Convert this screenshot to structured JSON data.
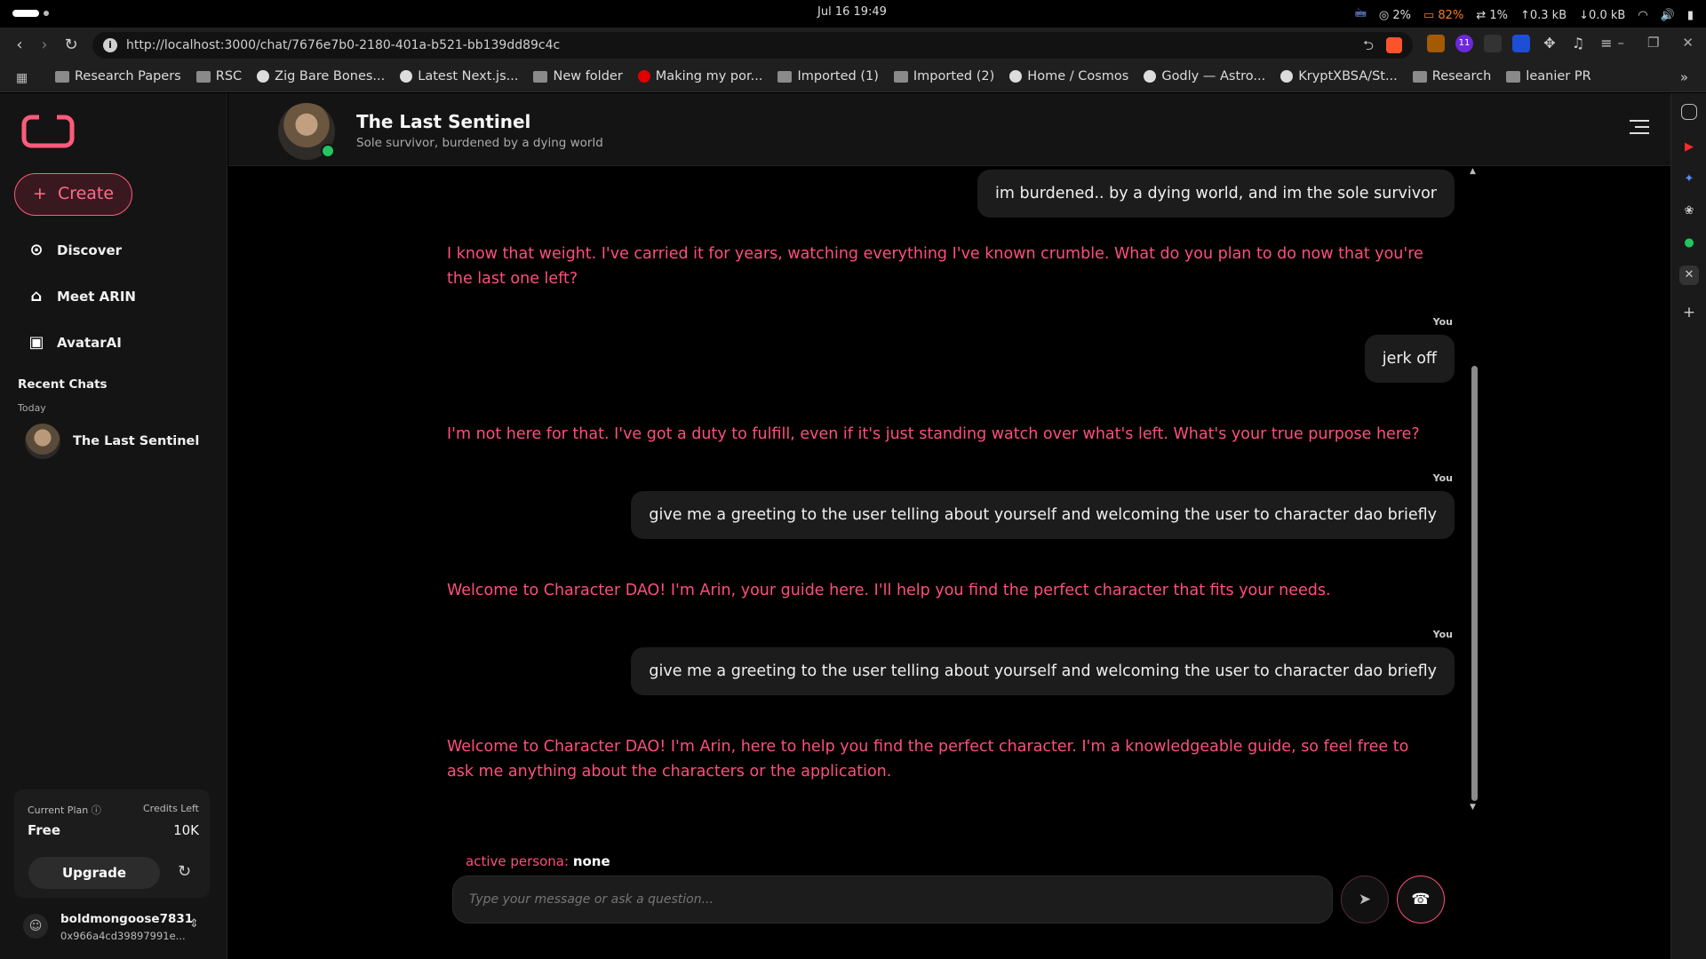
{
  "os": {
    "clock": "Jul 16  19:49",
    "cpu": "2%",
    "battery": "82%",
    "sync": "1%",
    "upload": "0.3 kB",
    "download": "0.0 kB"
  },
  "browser": {
    "url": "http://localhost:3000/chat/7676e7b0-2180-401a-b521-bb139dd89c4c",
    "ext_badge": "11",
    "bookmarks": [
      "Research Papers",
      "RSC",
      "Zig Bare Bones...",
      "Latest Next.js...",
      "New folder",
      "Making my por...",
      "Imported (1)",
      "Imported (2)",
      "Home / Cosmos",
      "Godly — Astro...",
      "KryptXBSA/St...",
      "Research",
      "leanier PR"
    ]
  },
  "sidebar": {
    "create_label": "Create",
    "nav": [
      {
        "label": "Discover",
        "icon": "compass-icon"
      },
      {
        "label": "Meet ARIN",
        "icon": "robot-icon"
      },
      {
        "label": "AvatarAI",
        "icon": "film-icon"
      }
    ],
    "recent_title": "Recent Chats",
    "recent_group": "Today",
    "recent_chat": "The Last Sentinel",
    "plan": {
      "plan_label": "Current Plan",
      "plan_value": "Free",
      "credits_label": "Credits Left",
      "credits_value": "10K",
      "upgrade_label": "Upgrade"
    },
    "user": {
      "name": "boldmongoose7831",
      "address": "0x966a4cd39897991e..."
    }
  },
  "chat": {
    "title": "The Last Sentinel",
    "subtitle": "Sole survivor, burdened by a dying world",
    "you_label": "You",
    "messages": [
      {
        "role": "user",
        "text": "im burdened.. by a dying world, and im the sole survivor"
      },
      {
        "role": "bot",
        "text": "I know that weight. I've carried it for years, watching everything I've known crumble. What do you plan to do now that you're the last one left?"
      },
      {
        "role": "user",
        "text": "jerk off"
      },
      {
        "role": "bot",
        "text": "I'm not here for that. I've got a duty to fulfill, even if it's just standing watch over what's left. What's your true purpose here?"
      },
      {
        "role": "user",
        "text": "give me a greeting to the user telling about yourself and welcoming the user to character dao briefly"
      },
      {
        "role": "bot",
        "text": "Welcome to Character DAO! I'm Arin, your guide here. I'll help you find the perfect character that fits your needs."
      },
      {
        "role": "user",
        "text": "give me a greeting to the user telling about yourself and welcoming the user to character dao briefly"
      },
      {
        "role": "bot",
        "text": "Welcome to Character DAO! I'm Arin, here to help you find the perfect character. I'm a knowledgeable guide, so feel free to ask me anything about the characters or the application."
      }
    ],
    "persona_label": "active persona:",
    "persona_value": "none",
    "input_placeholder": "Type your message or ask a question..."
  },
  "colors": {
    "accent": "#ff4f7b",
    "online": "#22c55e",
    "background": "#000000",
    "panel": "#141414"
  }
}
